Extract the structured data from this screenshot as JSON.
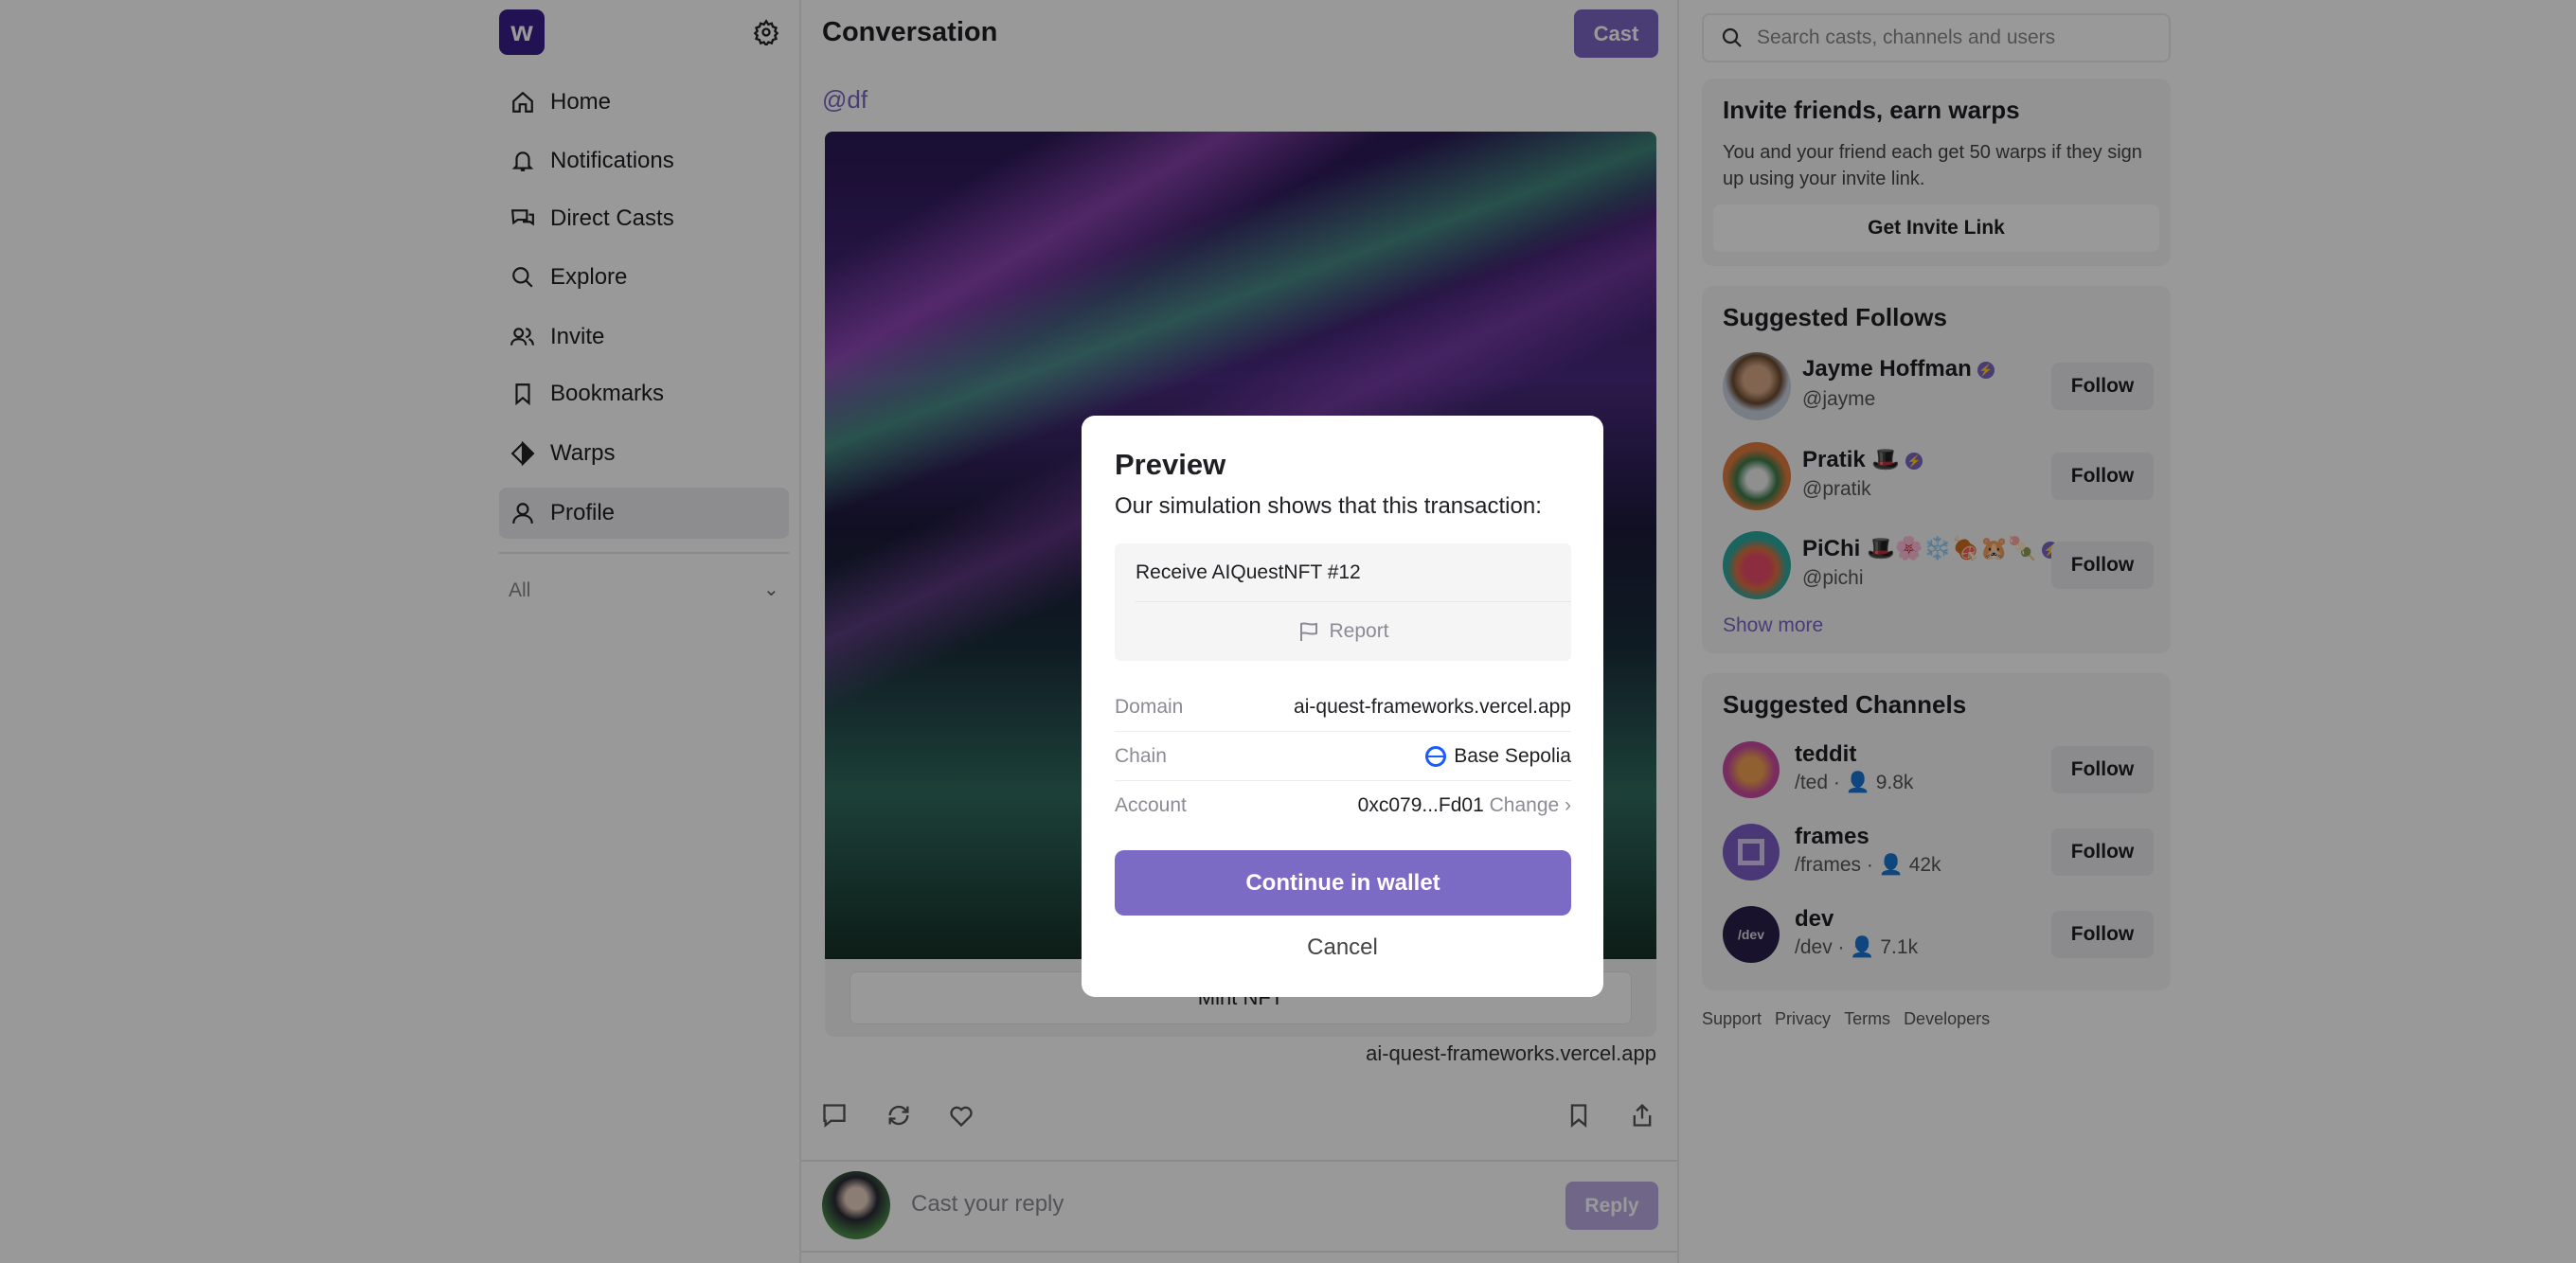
{
  "sidebar": {
    "logo": "w",
    "items": [
      {
        "label": "Home",
        "icon": "home-icon"
      },
      {
        "label": "Notifications",
        "icon": "bell-icon"
      },
      {
        "label": "Direct Casts",
        "icon": "chat-icon"
      },
      {
        "label": "Explore",
        "icon": "search-icon"
      },
      {
        "label": "Invite",
        "icon": "users-icon"
      },
      {
        "label": "Bookmarks",
        "icon": "bookmark-icon"
      },
      {
        "label": "Warps",
        "icon": "diamond-icon"
      },
      {
        "label": "Profile",
        "icon": "user-icon",
        "active": true
      }
    ],
    "filter": "All"
  },
  "main": {
    "title": "Conversation",
    "cast_label": "Cast",
    "handle": "@df",
    "frame_button": "Mint NFT",
    "frame_domain": "ai-quest-frameworks.vercel.app",
    "reply_placeholder": "Cast your reply",
    "reply_label": "Reply"
  },
  "right": {
    "search_placeholder": "Search casts, channels and users",
    "invite": {
      "title": "Invite friends, earn warps",
      "text": "You and your friend each get 50 warps if they sign up using your invite link.",
      "button": "Get Invite Link"
    },
    "follows": {
      "title": "Suggested Follows",
      "users": [
        {
          "name": "Jayme Hoffman",
          "handle": "@jayme",
          "follow": "Follow"
        },
        {
          "name": "Pratik 🎩",
          "handle": "@pratik",
          "follow": "Follow"
        },
        {
          "name": "PiChi 🎩🌸❄️🍖🐹🍡",
          "handle": "@pichi",
          "follow": "Follow"
        }
      ],
      "show_more": "Show more"
    },
    "channels": {
      "title": "Suggested Channels",
      "items": [
        {
          "name": "teddit",
          "path": "/ted",
          "members": "9.8k",
          "follow": "Follow"
        },
        {
          "name": "frames",
          "path": "/frames",
          "members": "42k",
          "follow": "Follow"
        },
        {
          "name": "dev",
          "path": "/dev",
          "members": "7.1k",
          "follow": "Follow",
          "avatar_text": "/dev"
        }
      ]
    },
    "footer": [
      "Support",
      "Privacy",
      "Terms",
      "Developers"
    ]
  },
  "modal": {
    "title": "Preview",
    "subtitle": "Our simulation shows that this transaction:",
    "receive": "Receive AIQuestNFT #12",
    "report": "Report",
    "rows": [
      {
        "label": "Domain",
        "value": "ai-quest-frameworks.vercel.app"
      },
      {
        "label": "Chain",
        "value": "Base Sepolia"
      },
      {
        "label": "Account",
        "value": "0xc079...Fd01",
        "action": "Change ›"
      }
    ],
    "continue": "Continue in wallet",
    "cancel": "Cancel"
  },
  "colors": {
    "accent": "#7c65c1",
    "logo": "#3b1f8a",
    "chain": "#1a5cff"
  }
}
